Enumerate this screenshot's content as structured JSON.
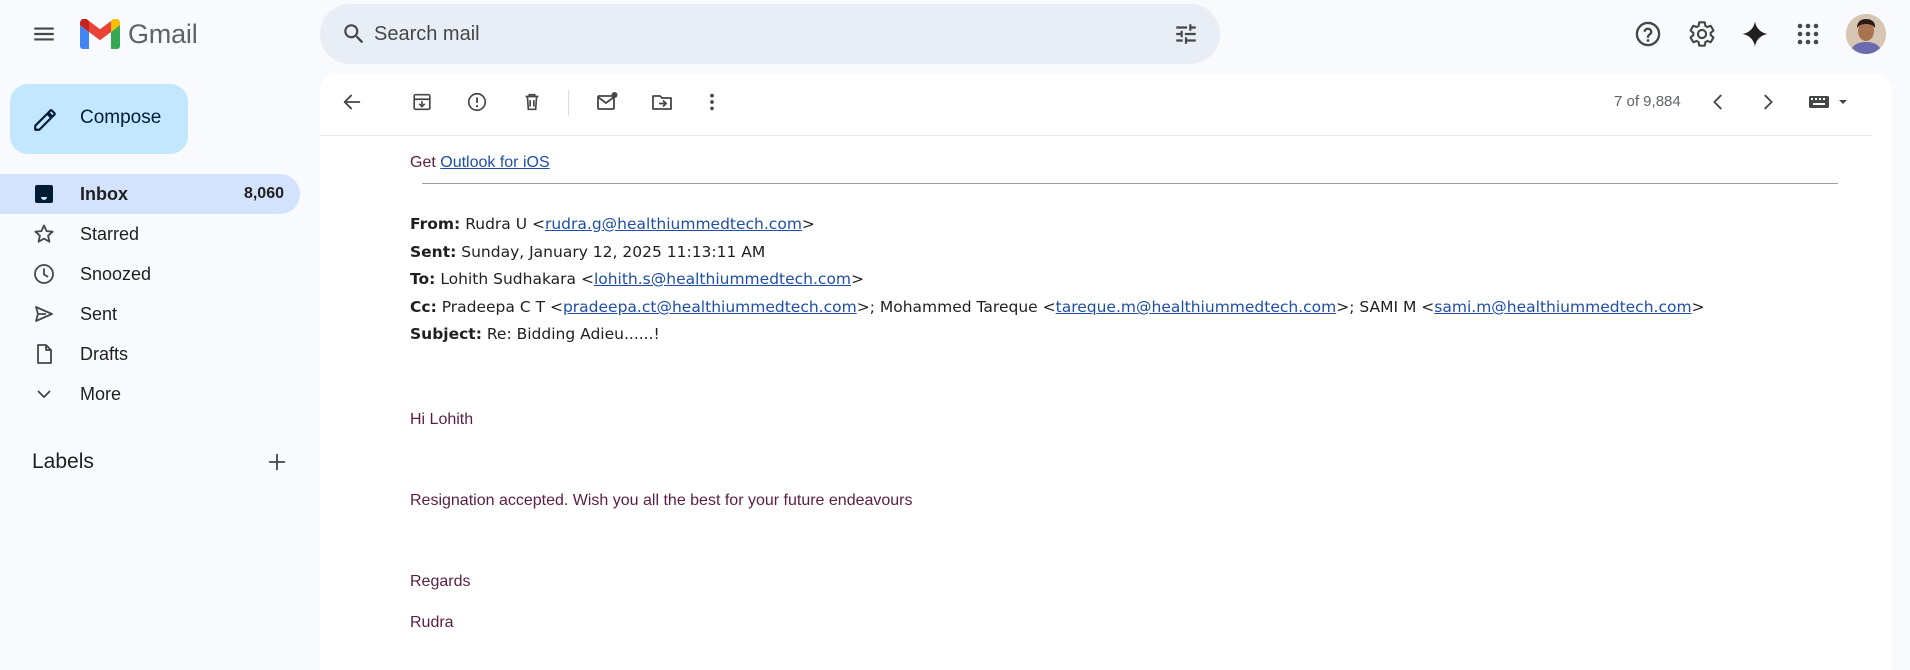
{
  "app": {
    "name": "Gmail"
  },
  "search": {
    "placeholder": "Search mail"
  },
  "compose": {
    "label": "Compose"
  },
  "sidebar": {
    "items": [
      {
        "label": "Inbox",
        "count": "8,060",
        "icon": "inbox-icon",
        "active": true
      },
      {
        "label": "Starred",
        "icon": "star-icon"
      },
      {
        "label": "Snoozed",
        "icon": "clock-icon"
      },
      {
        "label": "Sent",
        "icon": "send-icon"
      },
      {
        "label": "Drafts",
        "icon": "draft-icon"
      },
      {
        "label": "More",
        "icon": "chevron-down-icon"
      }
    ],
    "labels_heading": "Labels"
  },
  "toolbar": {
    "pager": "7 of 9,884",
    "icons": [
      "back-arrow-icon",
      "archive-icon",
      "report-spam-icon",
      "delete-icon",
      "mark-unread-icon",
      "move-to-icon",
      "more-vert-icon",
      "chevron-left-icon",
      "chevron-right-icon",
      "keyboard-icon"
    ]
  },
  "email": {
    "get_prefix": "Get",
    "get_link": "Outlook for iOS",
    "from": {
      "label": "From:",
      "name": "Rudra U <",
      "email": "rudra.g@healthiummedtech.com",
      "suffix": ">"
    },
    "sent": {
      "label": "Sent:",
      "value": "Sunday, January 12, 2025 11:13:11 AM"
    },
    "to": {
      "label": "To:",
      "name": "Lohith Sudhakara <",
      "email": "lohith.s@healthiummedtech.com",
      "suffix": ">"
    },
    "cc": {
      "label": "Cc:",
      "p1": "Pradeepa C T <",
      "e1": "pradeepa.ct@healthiummedtech.com",
      "p2": ">; Mohammed Tareque <",
      "e2": "tareque.m@healthiummedtech.com",
      "p3": ">; SAMI M <",
      "e3": "sami.m@healthiummedtech.com",
      "p4": ">"
    },
    "subject": {
      "label": "Subject:",
      "value": "Re: Bidding Adieu......!"
    },
    "greeting": "Hi Lohith",
    "message": "Resignation accepted. Wish you all the best for your future endeavours",
    "closing": "Regards",
    "signature": "Rudra"
  },
  "colors": {
    "accent": "#c2e7ff",
    "active_nav": "#d3e3fd",
    "body_text": "#5a1e45",
    "link": "#1f4ea8"
  }
}
